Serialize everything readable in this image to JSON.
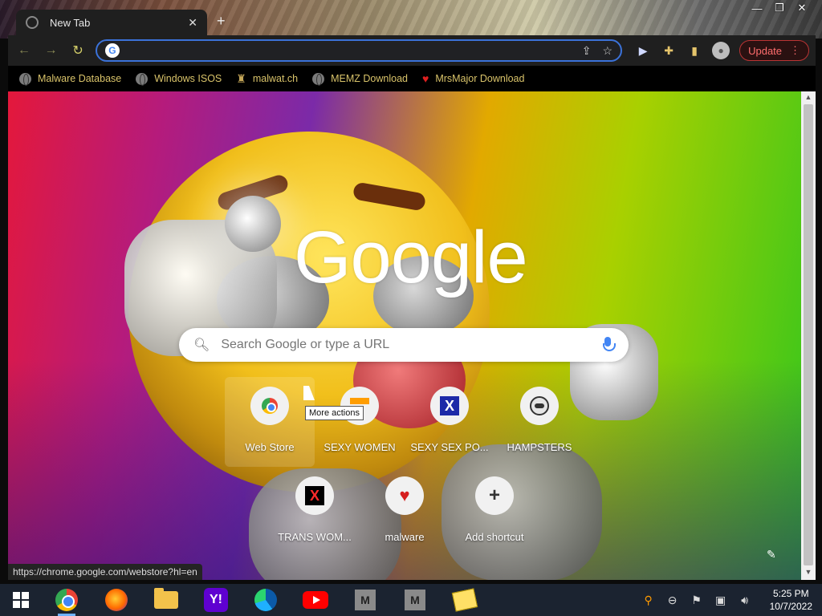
{
  "window": {
    "tab_title": "New Tab",
    "tab_close": "✕",
    "new_tab": "+",
    "controls": [
      "—",
      "❐",
      "✕"
    ]
  },
  "toolbar": {
    "back": "←",
    "forward": "→",
    "reload": "↻",
    "omnibox_value": "",
    "omnibox_placeholder": "",
    "share_icon": "⇪",
    "bookmark_star": "☆",
    "update_label": "Update",
    "menu_dots": "⋮"
  },
  "bookmarks": [
    {
      "label": "Malware Database",
      "icon": "globe-icon"
    },
    {
      "label": "Windows ISOS",
      "icon": "globe-icon"
    },
    {
      "label": "malwat.ch",
      "icon": "figure-icon"
    },
    {
      "label": "MEMZ Download",
      "icon": "globe-icon"
    },
    {
      "label": "MrsMajor Download",
      "icon": "heart-icon"
    }
  ],
  "page": {
    "logo": "Google",
    "search_placeholder": "Search Google or type a URL",
    "shortcuts": [
      {
        "label": "Web Store",
        "icon": "chrome-web-store-icon"
      },
      {
        "label": "SEXY WOMEN",
        "icon": "bar-icon"
      },
      {
        "label": "SEXY SEX PO...",
        "icon": "x-blue-icon"
      },
      {
        "label": "HAMPSTERS",
        "icon": "hamster-icon"
      },
      {
        "label": "TRANS WOM...",
        "icon": "x-red-icon"
      },
      {
        "label": "malware",
        "icon": "heart-icon"
      },
      {
        "label": "Add shortcut",
        "icon": "plus-icon"
      }
    ],
    "tooltip": "More actions",
    "status_url": "https://chrome.google.com/webstore?hl=en"
  },
  "taskbar": {
    "time": "5:25 PM",
    "date": "10/7/2022"
  },
  "colors": {
    "accent_blue": "#3b72d9",
    "update_red": "#ff6d6d",
    "bookmark_text": "#d9c36a"
  }
}
